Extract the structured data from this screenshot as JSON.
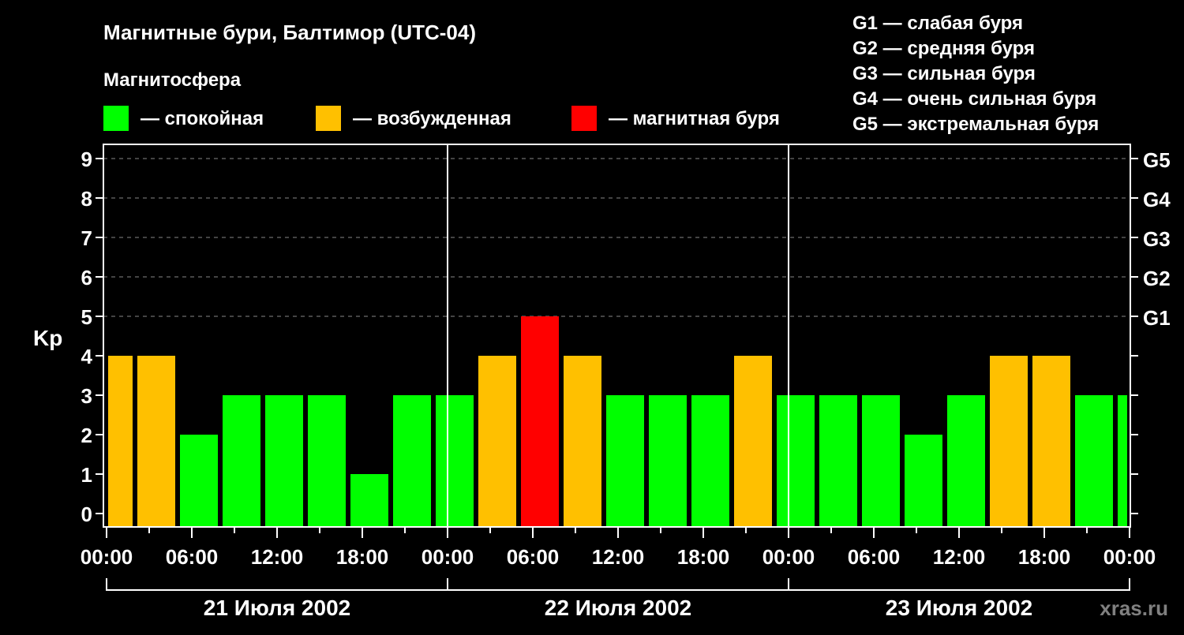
{
  "title": "Магнитные бури, Балтимор (UTC-04)",
  "legend_title": "Магнитосфера",
  "legend": [
    {
      "label": "— спокойная",
      "color": "#00FF00"
    },
    {
      "label": "— возбужденная",
      "color": "#FFC000"
    },
    {
      "label": "— магнитная буря",
      "color": "#FF0000"
    }
  ],
  "g_legend": [
    "G1 — слабая буря",
    "G2 — средняя буря",
    "G3 — сильная буря",
    "G4 — очень сильная буря",
    "G5 — экстремальная буря"
  ],
  "watermark": "xras.ru",
  "chart_data": {
    "type": "bar",
    "ylabel": "Kp",
    "ylim": [
      0,
      9
    ],
    "yticks": [
      "0",
      "1",
      "2",
      "3",
      "4",
      "5",
      "6",
      "7",
      "8",
      "9"
    ],
    "right_ticks": [
      {
        "kp": 5,
        "label": "G1"
      },
      {
        "kp": 6,
        "label": "G2"
      },
      {
        "kp": 7,
        "label": "G3"
      },
      {
        "kp": 8,
        "label": "G4"
      },
      {
        "kp": 9,
        "label": "G5"
      }
    ],
    "xlim_hours": [
      0,
      72
    ],
    "xtick_labels": [
      "00:00",
      "06:00",
      "12:00",
      "18:00",
      "00:00",
      "06:00",
      "12:00",
      "18:00",
      "00:00",
      "06:00",
      "12:00",
      "18:00",
      "00:00"
    ],
    "days": [
      "21 Июля 2002",
      "22 Июля 2002",
      "23 Июля 2002"
    ],
    "interval_start_hours": [
      -1,
      2,
      5,
      8,
      11,
      14,
      17,
      20,
      23,
      26,
      29,
      32,
      35,
      38,
      41,
      44,
      47,
      50,
      53,
      56,
      59,
      62,
      65,
      68,
      71
    ],
    "values": [
      4,
      4,
      2,
      3,
      3,
      3,
      1,
      3,
      3,
      4,
      5,
      4,
      3,
      3,
      3,
      4,
      3,
      3,
      3,
      2,
      3,
      4,
      4,
      3,
      3
    ],
    "colors": {
      "quiet": "#00FF00",
      "active": "#FFC000",
      "storm": "#FF0000"
    }
  }
}
